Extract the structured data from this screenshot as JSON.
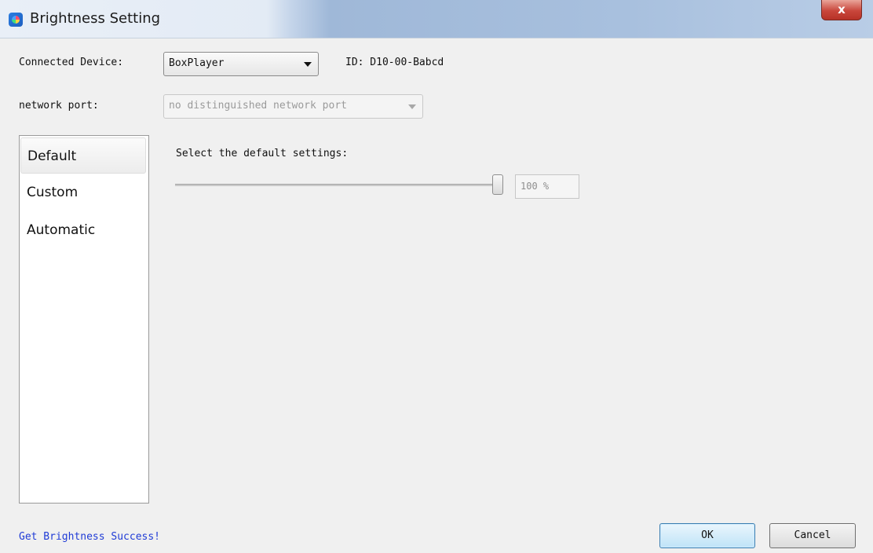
{
  "window": {
    "title": "Brightness Setting",
    "close_label": "x"
  },
  "device": {
    "label": "Connected Device:",
    "selected": "BoxPlayer",
    "id_text": "ID: D10-00-Babcd"
  },
  "network": {
    "label": "network port:",
    "selected": "no distinguished network port"
  },
  "sidebar": {
    "items": [
      {
        "label": "Default",
        "active": true
      },
      {
        "label": "Custom",
        "active": false
      },
      {
        "label": "Automatic",
        "active": false
      }
    ]
  },
  "main": {
    "heading": "Select the default settings:",
    "brightness_value": 100,
    "brightness_text": "100 %"
  },
  "status": {
    "message": "Get Brightness Success!",
    "color": "#1f3bd6"
  },
  "buttons": {
    "ok": "OK",
    "cancel": "Cancel"
  }
}
